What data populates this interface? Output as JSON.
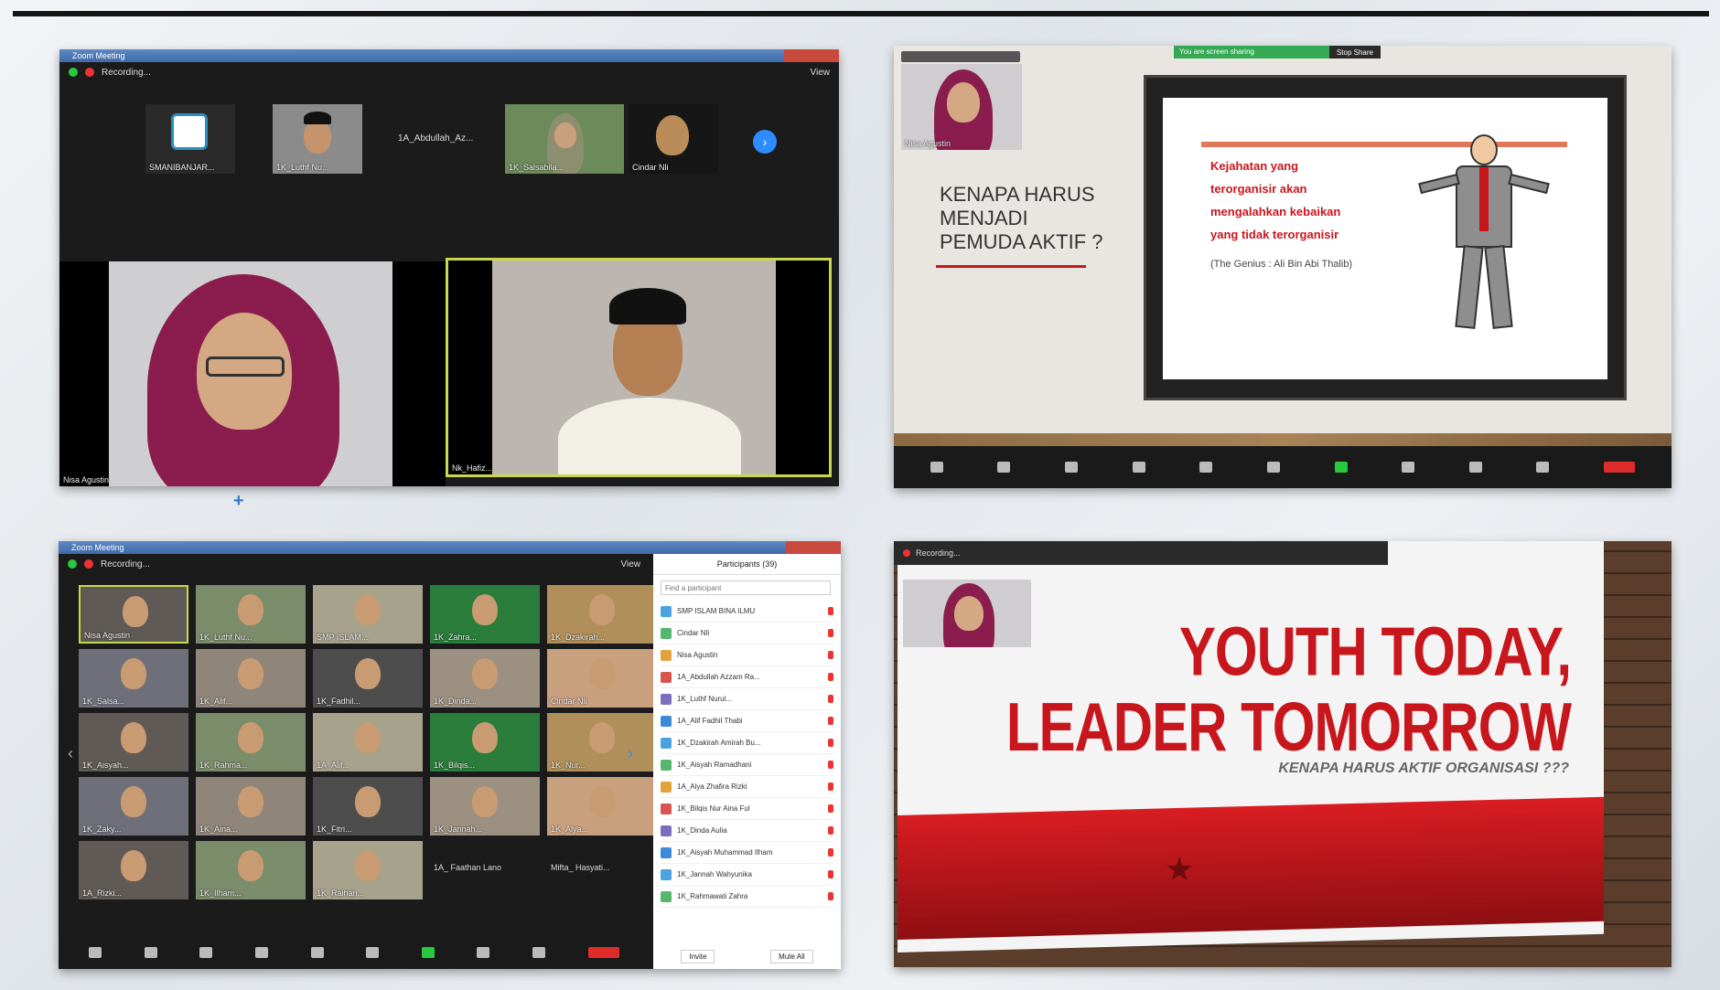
{
  "panel1": {
    "window_title": "Zoom Meeting",
    "recording_label": "Recording...",
    "view_label": "View",
    "strip": [
      {
        "name": "SMANIBANJAR..."
      },
      {
        "name": "1K_Luthf Nu..."
      },
      {
        "name": "1A_Abdullah_Az..."
      },
      {
        "name": "1K_Salsabila..."
      },
      {
        "name": "Cindar Nli"
      }
    ],
    "speakers": [
      {
        "name": "Nisa Agustin"
      },
      {
        "name": "Nk_Hafiz..."
      }
    ]
  },
  "panel2": {
    "thumb_name": "Nisa Agustin",
    "sharing_label": "You are screen sharing",
    "stop_label": "Stop Share",
    "title_lines": [
      "KENAPA HARUS",
      "MENJADI",
      "PEMUDA AKTIF ?"
    ],
    "quote_lines": [
      "Kejahatan yang",
      "terorganisir akan",
      "mengalahkan kebaikan",
      "yang tidak terorganisir"
    ],
    "quote_source": "(The Genius : Ali Bin Abi Thalib)"
  },
  "panel3": {
    "window_title": "Zoom Meeting",
    "recording_label": "Recording...",
    "view_label": "View",
    "participants_title": "Participants (39)",
    "search_placeholder": "Find a participant",
    "participants": [
      "SMP ISLAM BINA ILMU",
      "Cindar Nli",
      "Nisa Agustin",
      "1A_Abdullah Azzam Ra...",
      "1K_Luthf Nurul...",
      "1A_Alif Fadhil Thabi",
      "1K_Dzakirah Amirah Bu...",
      "1K_Aisyah Ramadhani",
      "1A_Alya Zhafira Rizki",
      "1K_Bilqis Nur Aina Ful",
      "1K_Dinda Aulia",
      "1K_Aisyah Muhammad Ilham",
      "1K_Jannah Wahyunika",
      "1K_Rahmawati Zahra"
    ],
    "mute_all_label": "Invite",
    "more_label": "Mute All",
    "grid_names": [
      "Nisa Agustin",
      "1K_Luthf Nu...",
      "SMP ISLAM...",
      "1K_Zahra...",
      "1K_Dzakirah...",
      "1K_Salsa...",
      "1K_Alif...",
      "1K_Fadhil...",
      "1K_Dinda...",
      "Cindar Nli",
      "1K_Aisyah...",
      "1K_Rahma...",
      "1A_Alif...",
      "1K_Bilqis...",
      "1K_Nur...",
      "1K_Zaky...",
      "1K_Aina...",
      "1K_Fitri...",
      "1K_Jannah...",
      "1K_Alya...",
      "1A_Rizki...",
      "1K_Ilham...",
      "1K_Raihan..."
    ],
    "text_tiles": [
      "1A_ Faathan Lano",
      "Mifta_ Hasyati..."
    ]
  },
  "panel4": {
    "recording_label": "Recording...",
    "headline_line1": "YOUTH TODAY,",
    "headline_line2": "LEADER TOMORROW",
    "subtitle": "KENAPA HARUS AKTIF ORGANISASI ???"
  },
  "colors": {
    "zoom_green": "#27c93f",
    "zoom_blue": "#2d8cff",
    "end_red": "#e02b2b",
    "slide_red": "#c8161d",
    "hijab_maroon": "#8a1d4e"
  }
}
